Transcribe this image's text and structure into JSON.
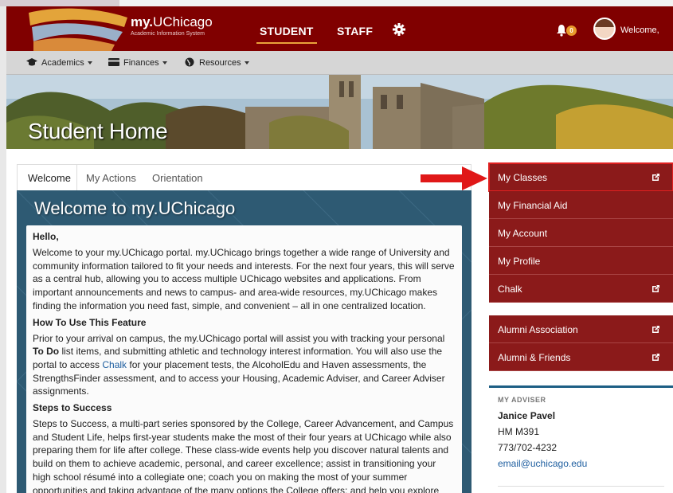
{
  "header": {
    "brand_main": "my.",
    "brand_rest": "UChicago",
    "brand_sub": "Academic Information System",
    "nav": [
      {
        "label": "STUDENT",
        "active": true
      },
      {
        "label": "STAFF",
        "active": false
      }
    ],
    "notification_count": "0",
    "welcome": "Welcome,",
    "colors": {
      "maroon": "#800000",
      "accent": "#e9a23b"
    }
  },
  "subnav": {
    "items": [
      {
        "label": "Academics",
        "icon": "graduation-cap-icon"
      },
      {
        "label": "Finances",
        "icon": "credit-card-icon"
      },
      {
        "label": "Resources",
        "icon": "globe-icon"
      }
    ]
  },
  "hero": {
    "title": "Student Home"
  },
  "tabs": [
    {
      "label": "Welcome",
      "active": true
    },
    {
      "label": "My Actions",
      "active": false
    },
    {
      "label": "Orientation",
      "active": false
    }
  ],
  "welcome_panel": {
    "title": "Welcome to my.UChicago",
    "greeting": "Hello,",
    "intro": "Welcome to your my.UChicago portal. my.UChicago brings together a wide range of University and community information tailored to fit your needs and interests. For the next four years, this will serve as a central hub, allowing you to access multiple UChicago websites and applications. From important announcements and news to campus- and area-wide resources, my.UChicago makes finding the information you need fast, simple, and convenient – all in one centralized location.",
    "howto_heading": "How To Use This Feature",
    "howto_1": "Prior to your arrival on campus, the my.UChicago portal will assist you with tracking your personal ",
    "howto_bold": "To Do",
    "howto_2": " list items, and submitting athletic and technology interest information. You will also use the portal to access ",
    "howto_link": "Chalk",
    "howto_3": " for your placement tests, the AlcoholEdu and Haven assessments, the StrengthsFinder assessment, and to access your Housing, Academic Adviser, and Career Adviser assignments.",
    "steps_heading": "Steps to Success",
    "steps_text": "Steps to Success, a multi-part series sponsored by the College, Career Advancement, and Campus and Student Life, helps first-year students make the most of their four years at UChicago while also preparing them for life after college. These class-wide events help you discover natural talents and build on them to achieve academic, personal, and career excellence; assist in transitioning your high school résumé into a collegiate one; coach you on making the most of your summer opportunities and taking advantage of the many options the College offers; and help you explore post-college options, including"
  },
  "right_menu": {
    "group1": [
      {
        "label": "My Classes",
        "external": true,
        "highlighted": true
      },
      {
        "label": "My Financial Aid",
        "external": false
      },
      {
        "label": "My Account",
        "external": false
      },
      {
        "label": "My Profile",
        "external": false
      },
      {
        "label": "Chalk",
        "external": true
      }
    ],
    "group2": [
      {
        "label": "Alumni Association",
        "external": true
      },
      {
        "label": "Alumni & Friends",
        "external": true
      }
    ]
  },
  "adviser": {
    "label": "MY ADVISER",
    "name": "Janice Pavel",
    "office": "HM M391",
    "phone": "773/702-4232",
    "email": "email@uchicago.edu"
  }
}
